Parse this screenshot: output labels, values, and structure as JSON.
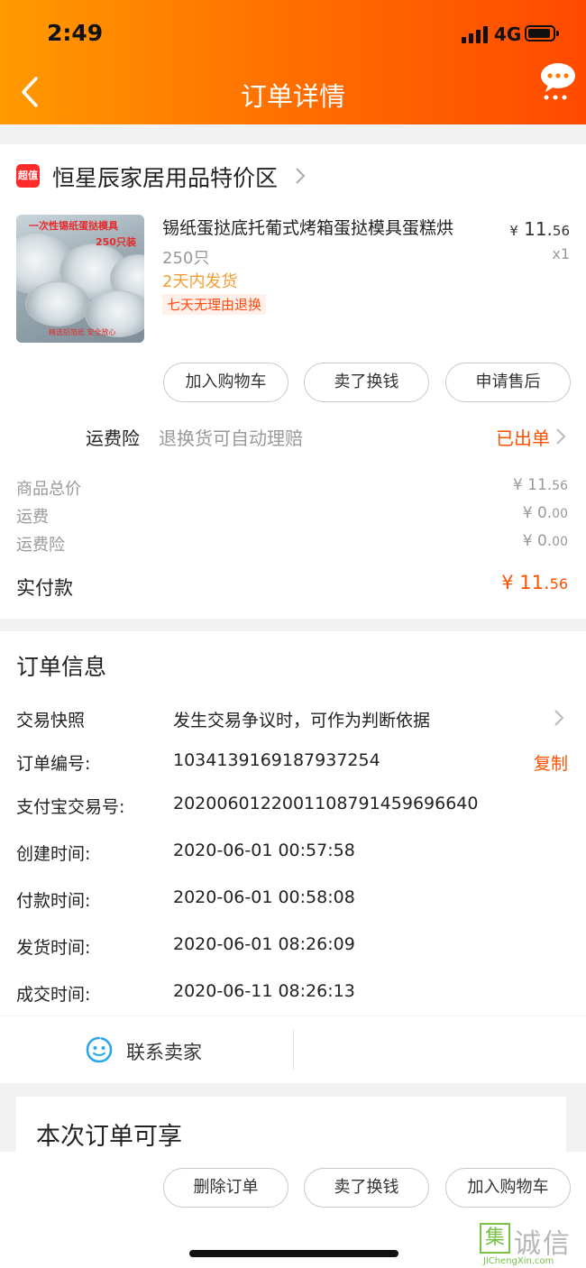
{
  "status_bar": {
    "time": "2:49",
    "network": "4G"
  },
  "header": {
    "title": "订单详情"
  },
  "shop": {
    "badge": "超值",
    "name": "恒星辰家居用品特价区"
  },
  "product": {
    "image_text_1": "一次性锡纸蛋挞模具",
    "image_text_2": "250只装",
    "image_text_3": "精选铝箔纸 安全放心",
    "title": "锡纸蛋挞底托葡式烤箱蛋挞模具蛋糕烘",
    "spec": "250只",
    "shipping": "2天内发货",
    "tag": "七天无理由退换",
    "price_symbol": "¥",
    "price_int": "11.",
    "price_dec": "56",
    "quantity": "x1"
  },
  "actions": [
    "加入购物车",
    "卖了换钱",
    "申请售后"
  ],
  "insurance": {
    "label": "运费险",
    "desc": "退换货可自动理赔",
    "status": "已出单"
  },
  "summary": [
    {
      "label": "商品总价",
      "int": "¥ 11.",
      "dec": "56"
    },
    {
      "label": "运费",
      "int": "¥ 0.",
      "dec": "00"
    },
    {
      "label": "运费险",
      "int": "¥ 0.",
      "dec": "00"
    }
  ],
  "paid": {
    "label": "实付款",
    "int": "¥ 11.",
    "dec": "56"
  },
  "order_info": {
    "title": "订单信息",
    "snapshot_label": "交易快照",
    "snapshot_desc": "发生交易争议时，可作为判断依据",
    "order_no_label": "订单编号:",
    "order_no": "1034139169187937254",
    "copy": "复制",
    "alipay_label": "支付宝交易号:",
    "alipay_no": "2020060122001108791459696640",
    "created_label": "创建时间:",
    "created": "2020-06-01 00:57:58",
    "paid_label": "付款时间:",
    "paid": "2020-06-01 00:58:08",
    "shipped_label": "发货时间:",
    "shipped": "2020-06-01 08:26:09",
    "completed_label": "成交时间:",
    "completed": "2020-06-11 08:26:13"
  },
  "contact": {
    "label": "联系卖家"
  },
  "promo": {
    "title": "本次订单可享"
  },
  "bottom_actions": [
    "删除订单",
    "卖了换钱",
    "加入购物车"
  ],
  "watermark": {
    "mark": "集",
    "text": "诚信",
    "url": "JiChengXin.com"
  },
  "colors": {
    "accent": "#ff5000",
    "header_start": "#ff9a00",
    "header_end": "#ff4a00",
    "ship": "#f0a030"
  }
}
